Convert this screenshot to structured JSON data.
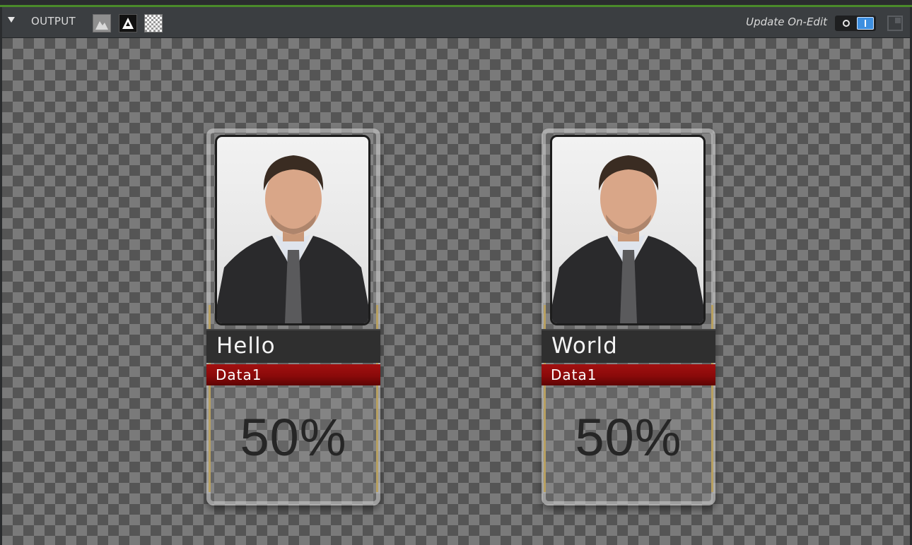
{
  "toolbar": {
    "output_label": "OUTPUT",
    "update_label": "Update On-Edit",
    "accent_color": "#4a8a2a",
    "icons": [
      "collapse-triangle-icon",
      "rgb-view-icon",
      "alpha-view-icon",
      "transparency-view-icon",
      "toggle-switch",
      "popout-icon"
    ]
  },
  "cards": [
    {
      "name": "Hello",
      "data_label": "Data1",
      "percent": "50%"
    },
    {
      "name": "World",
      "data_label": "Data1",
      "percent": "50%"
    }
  ],
  "colors": {
    "data_bar": "#8a0a0a",
    "name_bar": "#2f2f2f",
    "toggle_on": "#3d8fe0"
  }
}
